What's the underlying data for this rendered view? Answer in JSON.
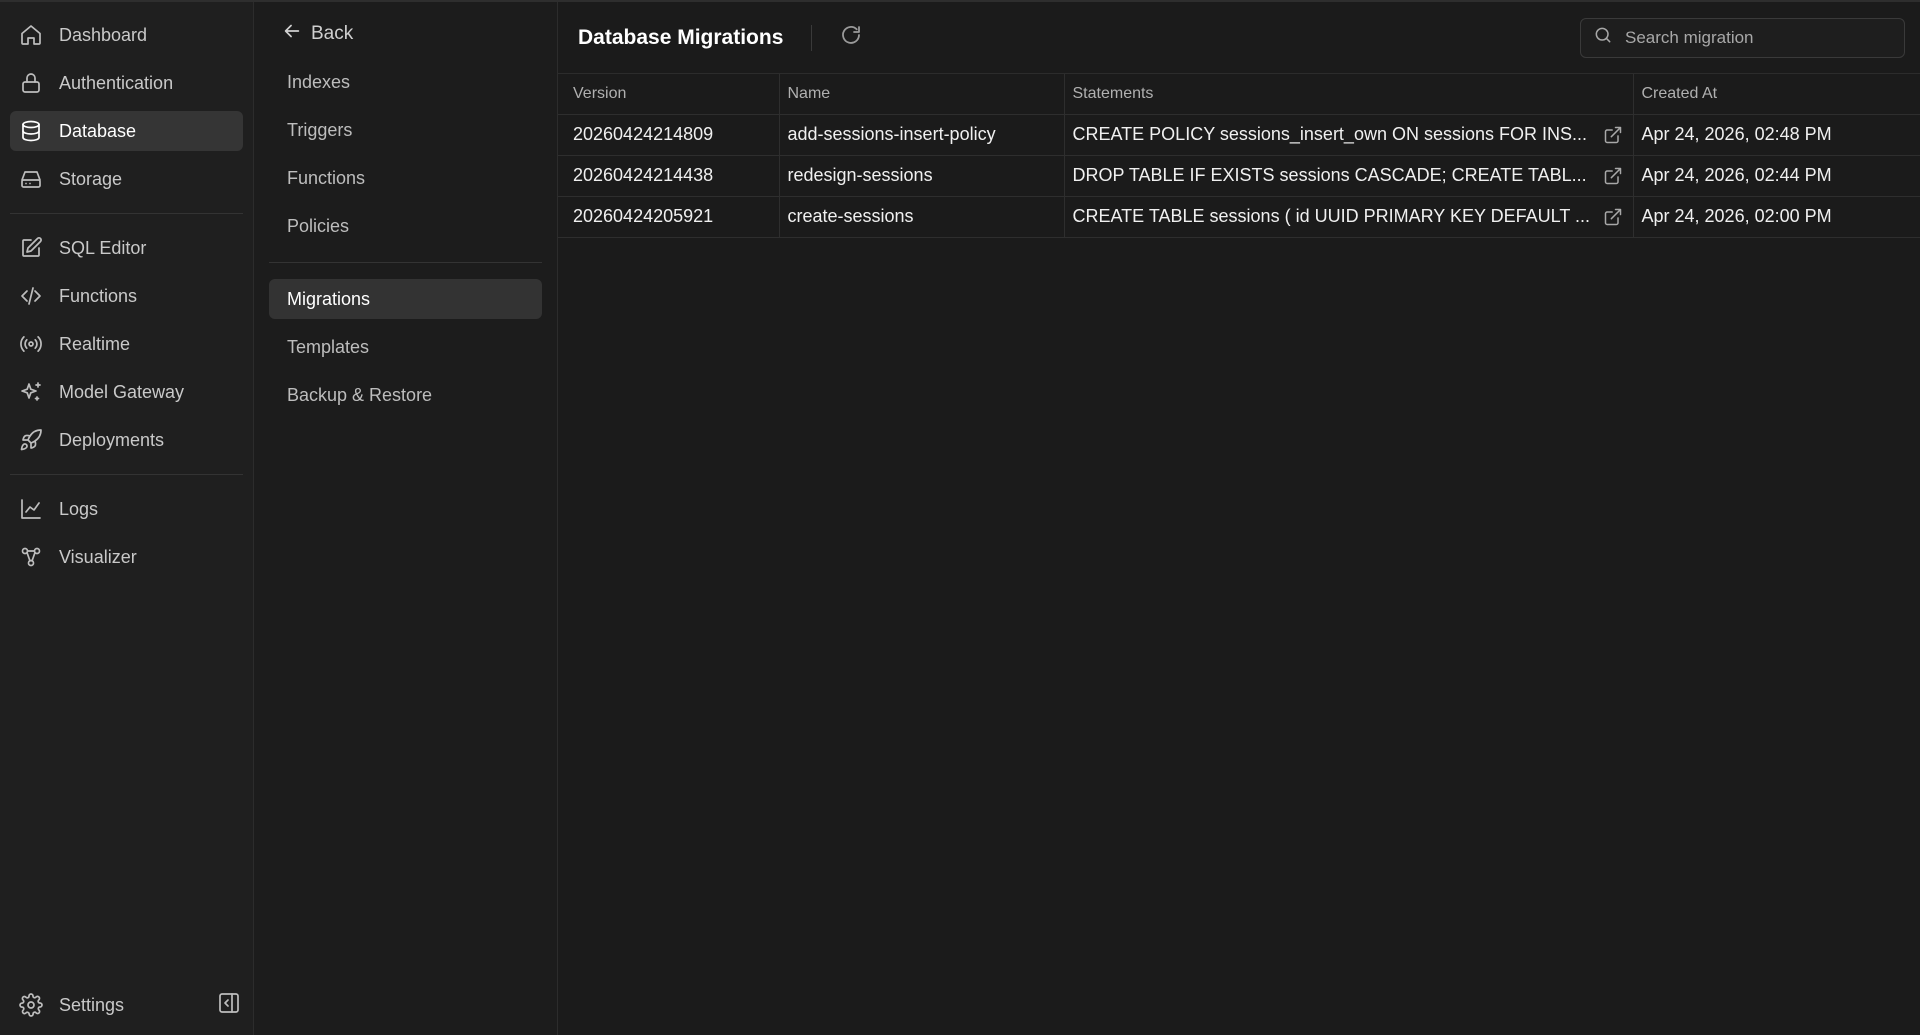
{
  "sidebar": {
    "groups": [
      [
        {
          "label": "Dashboard",
          "icon": "home-icon"
        },
        {
          "label": "Authentication",
          "icon": "lock-icon"
        },
        {
          "label": "Database",
          "icon": "database-icon",
          "active": true
        },
        {
          "label": "Storage",
          "icon": "hard-drive-icon"
        }
      ],
      [
        {
          "label": "SQL Editor",
          "icon": "edit-icon"
        },
        {
          "label": "Functions",
          "icon": "code-icon"
        },
        {
          "label": "Realtime",
          "icon": "broadcast-icon"
        },
        {
          "label": "Model Gateway",
          "icon": "sparkles-icon"
        },
        {
          "label": "Deployments",
          "icon": "rocket-icon"
        }
      ],
      [
        {
          "label": "Logs",
          "icon": "line-chart-icon"
        },
        {
          "label": "Visualizer",
          "icon": "graph-icon"
        }
      ]
    ],
    "settings_label": "Settings"
  },
  "subnav": {
    "back_label": "Back",
    "group1": [
      "Indexes",
      "Triggers",
      "Functions",
      "Policies"
    ],
    "group2": [
      "Migrations",
      "Templates",
      "Backup & Restore"
    ],
    "active": "Migrations"
  },
  "header": {
    "title": "Database Migrations",
    "search_placeholder": "Search migration"
  },
  "table": {
    "columns": [
      "Version",
      "Name",
      "Statements",
      "Created At"
    ],
    "rows": [
      {
        "version": "20260424214809",
        "name": "add-sessions-insert-policy",
        "statements": "CREATE POLICY sessions_insert_own ON sessions FOR INS...",
        "created_at": "Apr 24, 2026, 02:48 PM"
      },
      {
        "version": "20260424214438",
        "name": "redesign-sessions",
        "statements": "DROP TABLE IF EXISTS sessions CASCADE; CREATE TABL...",
        "created_at": "Apr 24, 2026, 02:44 PM"
      },
      {
        "version": "20260424205921",
        "name": "create-sessions",
        "statements": "CREATE TABLE sessions ( id UUID PRIMARY KEY DEFAULT ...",
        "created_at": "Apr 24, 2026, 02:00 PM"
      }
    ]
  },
  "colors": {
    "background": "#1b1b1b",
    "sidebar": "#1f1f1f",
    "active_item": "#353535",
    "border": "#2e2e2e"
  }
}
